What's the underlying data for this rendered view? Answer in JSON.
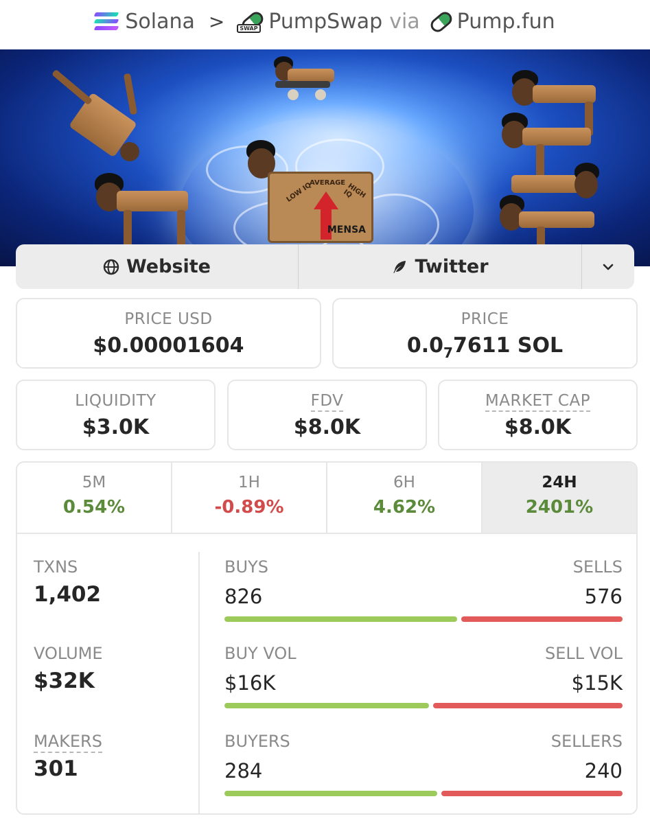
{
  "breadcrumb": {
    "chain": "Solana",
    "separator": ">",
    "dex": "PumpSwap",
    "dex_tag": "SWAP",
    "via": "via",
    "source": "Pump.fun"
  },
  "banner": {
    "sign_low": "LOW IQ",
    "sign_average": "AVERAGE",
    "sign_high": "HIGH IQ",
    "sign_brand": "MENSA"
  },
  "links": {
    "website": "Website",
    "twitter": "Twitter"
  },
  "price": {
    "usd_label": "PRICE USD",
    "usd_value": "$0.00001604",
    "native_label": "PRICE",
    "native_prefix": "0.0",
    "native_zeros": "7",
    "native_digits": "7611 SOL"
  },
  "metrics": {
    "liquidity_label": "LIQUIDITY",
    "liquidity_value": "$3.0K",
    "fdv_label": "FDV",
    "fdv_value": "$8.0K",
    "mcap_label": "MARKET CAP",
    "mcap_value": "$8.0K"
  },
  "timeframes": [
    {
      "label": "5M",
      "change": "0.54%",
      "direction": "up"
    },
    {
      "label": "1H",
      "change": "-0.89%",
      "direction": "down"
    },
    {
      "label": "6H",
      "change": "4.62%",
      "direction": "up"
    },
    {
      "label": "24H",
      "change": "2401%",
      "direction": "up",
      "active": true
    }
  ],
  "stats": {
    "txns_label": "TXNS",
    "txns_value": "1,402",
    "volume_label": "VOLUME",
    "volume_value": "$32K",
    "makers_label": "MAKERS",
    "makers_value": "301",
    "buys_label": "BUYS",
    "buys_value": "826",
    "sells_label": "SELLS",
    "sells_value": "576",
    "buyvol_label": "BUY VOL",
    "buyvol_value": "$16K",
    "sellvol_label": "SELL VOL",
    "sellvol_value": "$15K",
    "buyers_label": "BUYERS",
    "buyers_value": "284",
    "sellers_label": "SELLERS",
    "sellers_value": "240",
    "buy_fraction_txns": 0.59,
    "buy_fraction_volume": 0.52,
    "buy_fraction_makers": 0.54
  },
  "colors": {
    "positive": "#5a8a3a",
    "negative": "#d24b4b",
    "buy_bar": "#9ccb5c",
    "sell_bar": "#e35a5a"
  }
}
